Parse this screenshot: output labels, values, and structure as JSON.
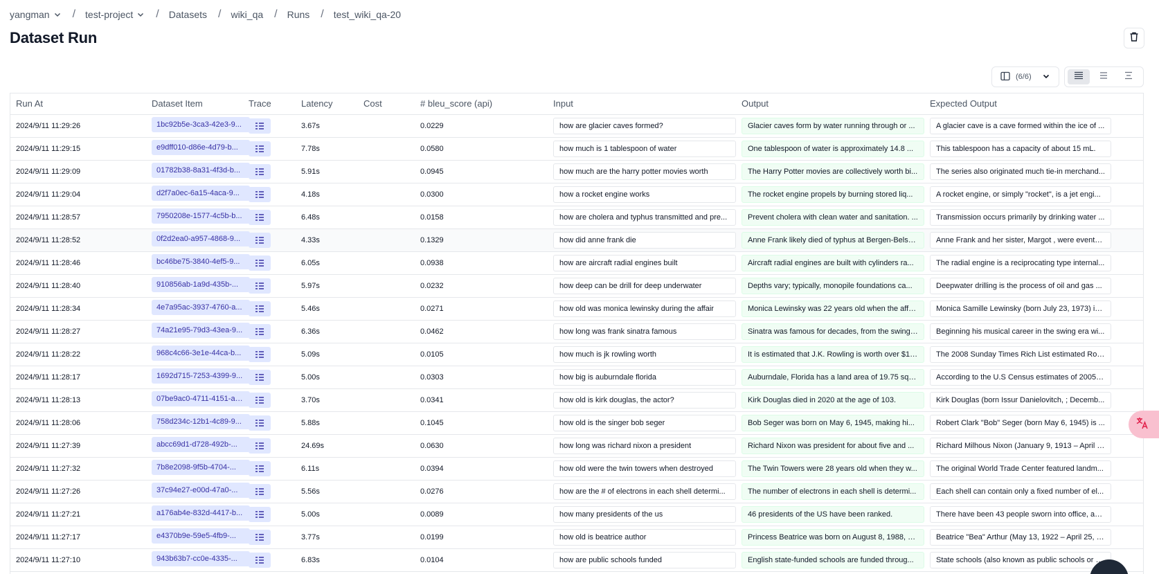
{
  "breadcrumb": {
    "org": "yangman",
    "project": "test-project",
    "datasets": "Datasets",
    "dataset": "wiki_qa",
    "runs": "Runs",
    "run": "test_wiki_qa-20",
    "separator": "/"
  },
  "page": {
    "title": "Dataset Run"
  },
  "toolbar": {
    "columns_count": "(6/6)",
    "density_options": [
      "density-comfortable-icon",
      "density-normal-icon",
      "density-compact-icon"
    ],
    "active_density": 0
  },
  "table": {
    "headers": [
      "Run At",
      "Dataset Item",
      "Trace",
      "Latency",
      "Cost",
      "# bleu_score (api)",
      "Input",
      "Output",
      "Expected Output"
    ],
    "rows": [
      {
        "run_at": "2024/9/11 11:29:26",
        "item": "1bc92b5e-3ca3-42e3-9...",
        "latency": "3.67s",
        "cost": "",
        "bleu": "0.0229",
        "input": "how are glacier caves formed?",
        "output": "Glacier caves form by water running through or ...",
        "expected": "A glacier cave is a cave formed within the ice of ..."
      },
      {
        "run_at": "2024/9/11 11:29:15",
        "item": "e9dff010-d86e-4d79-b...",
        "latency": "7.78s",
        "cost": "",
        "bleu": "0.0580",
        "input": "how much is 1 tablespoon of water",
        "output": "One tablespoon of water is approximately 14.8 ...",
        "expected": "This tablespoon has a capacity of about 15 mL."
      },
      {
        "run_at": "2024/9/11 11:29:09",
        "item": "01782b38-8a31-4f3d-b...",
        "latency": "5.91s",
        "cost": "",
        "bleu": "0.0945",
        "input": "how much are the harry potter movies worth",
        "output": "The Harry Potter movies are collectively worth bi...",
        "expected": "The series also originated much tie-in merchand..."
      },
      {
        "run_at": "2024/9/11 11:29:04",
        "item": "d2f7a0ec-6a15-4aca-9...",
        "latency": "4.18s",
        "cost": "",
        "bleu": "0.0300",
        "input": "how a rocket engine works",
        "output": "The rocket engine propels by burning stored liq...",
        "expected": "A rocket engine, or simply \"rocket\", is a jet engi..."
      },
      {
        "run_at": "2024/9/11 11:28:57",
        "item": "7950208e-1577-4c5b-b...",
        "latency": "6.48s",
        "cost": "",
        "bleu": "0.0158",
        "input": "how are cholera and typhus transmitted and pre...",
        "output": "Prevent cholera with clean water and sanitation. ...",
        "expected": "Transmission occurs primarily by drinking water ..."
      },
      {
        "run_at": "2024/9/11 11:28:52",
        "item": "0f2d2ea0-a957-4868-9...",
        "latency": "4.33s",
        "cost": "",
        "bleu": "0.1329",
        "input": "how did anne frank die",
        "output": "Anne Frank likely died of typhus at Bergen-Belse...",
        "expected": "Anne Frank and her sister, Margot , were eventu..."
      },
      {
        "run_at": "2024/9/11 11:28:46",
        "item": "bc46be75-3840-4ef5-9...",
        "latency": "6.05s",
        "cost": "",
        "bleu": "0.0938",
        "input": "how are aircraft radial engines built",
        "output": "Aircraft radial engines are built with cylinders ra...",
        "expected": "The radial engine is a reciprocating type internal..."
      },
      {
        "run_at": "2024/9/11 11:28:40",
        "item": "910856ab-1a9d-435b-...",
        "latency": "5.97s",
        "cost": "",
        "bleu": "0.0232",
        "input": "how deep can be drill for deep underwater",
        "output": "Depths vary; typically, monopile foundations ca...",
        "expected": "Deepwater drilling is the process of oil and gas ..."
      },
      {
        "run_at": "2024/9/11 11:28:34",
        "item": "4e7a95ac-3937-4760-a...",
        "latency": "5.46s",
        "cost": "",
        "bleu": "0.0271",
        "input": "how old was monica lewinsky during the affair",
        "output": "Monica Lewinsky was 22 years old when the affa...",
        "expected": "Monica Samille Lewinsky (born July 23, 1973) is ..."
      },
      {
        "run_at": "2024/9/11 11:28:27",
        "item": "74a21e95-79d3-43ea-9...",
        "latency": "6.36s",
        "cost": "",
        "bleu": "0.0462",
        "input": "how long was frank sinatra famous",
        "output": "Sinatra was famous for decades, from the swing ...",
        "expected": "Beginning his musical career in the swing era wi..."
      },
      {
        "run_at": "2024/9/11 11:28:22",
        "item": "968c4c66-3e1e-44ca-b...",
        "latency": "5.09s",
        "cost": "",
        "bleu": "0.0105",
        "input": "how much is jk rowling worth",
        "output": "It is estimated that J.K. Rowling is worth over $1 ...",
        "expected": "The 2008 Sunday Times Rich List estimated Rowl..."
      },
      {
        "run_at": "2024/9/11 11:28:17",
        "item": "1692d715-7253-4399-9...",
        "latency": "5.00s",
        "cost": "",
        "bleu": "0.0303",
        "input": "how big is auburndale florida",
        "output": "Auburndale, Florida has a land area of 19.75 squ...",
        "expected": "According to the U.S Census estimates of 2005, ..."
      },
      {
        "run_at": "2024/9/11 11:28:13",
        "item": "07be9ac0-4711-4151-a1...",
        "latency": "3.70s",
        "cost": "",
        "bleu": "0.0341",
        "input": "how old is kirk douglas, the actor?",
        "output": "Kirk Douglas died in 2020 at the age of 103.",
        "expected": "Kirk Douglas (born Issur Danielovitch, ; Decemb..."
      },
      {
        "run_at": "2024/9/11 11:28:06",
        "item": "758d234c-12b1-4c89-9...",
        "latency": "5.88s",
        "cost": "",
        "bleu": "0.1045",
        "input": "how old is the singer bob seger",
        "output": "Bob Seger was born on May 6, 1945, making hi...",
        "expected": "Robert Clark \"Bob\" Seger (born May 6, 1945) is ..."
      },
      {
        "run_at": "2024/9/11 11:27:39",
        "item": "abcc69d1-d728-492b-...",
        "latency": "24.69s",
        "cost": "",
        "bleu": "0.0630",
        "input": "how long was richard nixon a president",
        "output": "Richard Nixon was president for about five and ...",
        "expected": "Richard Milhous Nixon (January 9, 1913 – April 2..."
      },
      {
        "run_at": "2024/9/11 11:27:32",
        "item": "7b8e2098-9f5b-4704-...",
        "latency": "6.11s",
        "cost": "",
        "bleu": "0.0394",
        "input": "how old were the twin towers when destroyed",
        "output": "The Twin Towers were 28 years old when they w...",
        "expected": "The original World Trade Center featured landm..."
      },
      {
        "run_at": "2024/9/11 11:27:26",
        "item": "37c94e27-e00d-47a0-...",
        "latency": "5.56s",
        "cost": "",
        "bleu": "0.0276",
        "input": "how are the # of electrons in each shell determi...",
        "output": "The number of electrons in each shell is determi...",
        "expected": "Each shell can contain only a fixed number of el..."
      },
      {
        "run_at": "2024/9/11 11:27:21",
        "item": "a176ab4e-832d-4417-b...",
        "latency": "5.00s",
        "cost": "",
        "bleu": "0.0089",
        "input": "how many presidents of the us",
        "output": "46 presidents of the US have been ranked.",
        "expected": "There have been 43 people sworn into office, an..."
      },
      {
        "run_at": "2024/9/11 11:27:17",
        "item": "e4370b9e-59e5-4fb9-...",
        "latency": "3.77s",
        "cost": "",
        "bleu": "0.0199",
        "input": "how old is beatrice author",
        "output": "Princess Beatrice was born on August 8, 1988, m...",
        "expected": "Beatrice \"Bea\" Arthur (May 13, 1922 – April 25, 2..."
      },
      {
        "run_at": "2024/9/11 11:27:10",
        "item": "943b63b7-cc0e-4335-...",
        "latency": "6.83s",
        "cost": "",
        "bleu": "0.0104",
        "input": "how are public schools funded",
        "output": "English state-funded schools are funded throug...",
        "expected": "State schools (also known as public schools or g..."
      }
    ]
  },
  "colors": {
    "chip_bg": "#e0e7ff",
    "chip_text": "#3730a3",
    "output_bg": "#f0fdf4",
    "border": "#e5e7eb",
    "translate_fab": "#f9c0cf"
  },
  "icons": {
    "delete": "trash-icon",
    "columns": "columns-icon",
    "trace": "trace-list-icon",
    "translate": "translate-icon"
  }
}
